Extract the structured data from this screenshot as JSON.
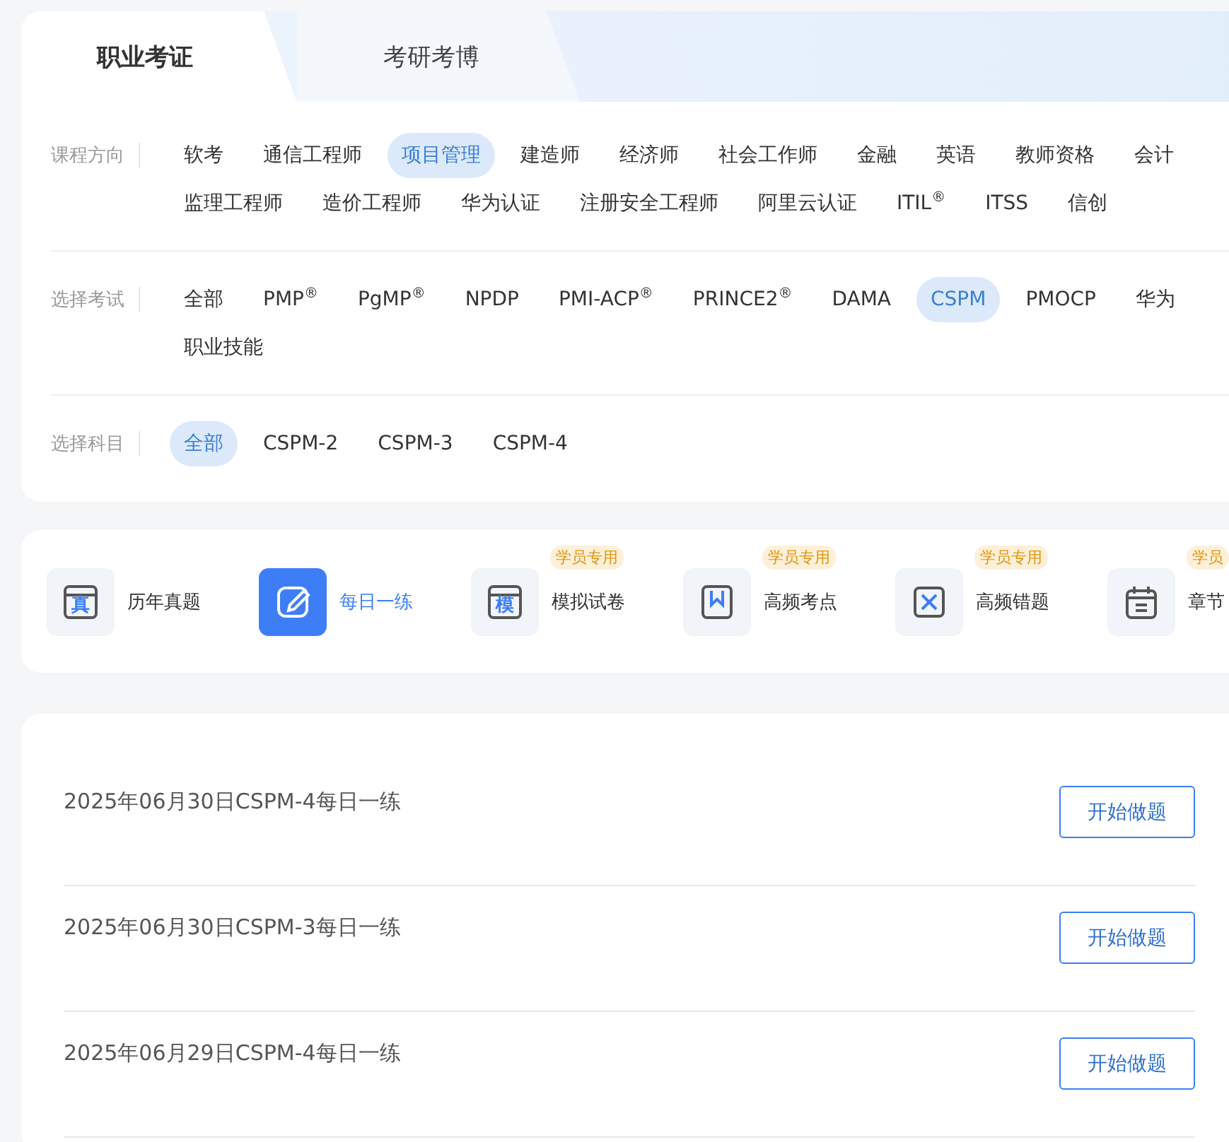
{
  "tabs": [
    {
      "label": "职业考证",
      "selected": true
    },
    {
      "label": "考研考博",
      "selected": false
    }
  ],
  "filters": [
    {
      "label": "课程方向",
      "options": [
        {
          "text": "软考",
          "selected": false
        },
        {
          "text": "通信工程师",
          "selected": false
        },
        {
          "text": "项目管理",
          "selected": true
        },
        {
          "text": "建造师",
          "selected": false
        },
        {
          "text": "经济师",
          "selected": false
        },
        {
          "text": "社会工作师",
          "selected": false
        },
        {
          "text": "金融",
          "selected": false
        },
        {
          "text": "英语",
          "selected": false
        },
        {
          "text": "教师资格",
          "selected": false
        },
        {
          "text": "会计",
          "selected": false
        },
        {
          "text": "监理工程师",
          "selected": false
        },
        {
          "text": "造价工程师",
          "selected": false
        },
        {
          "text": "华为认证",
          "selected": false
        },
        {
          "text": "注册安全工程师",
          "selected": false
        },
        {
          "text": "阿里云认证",
          "selected": false
        },
        {
          "text": "ITIL$^{®}$",
          "selected": false
        },
        {
          "text": "ITSS",
          "selected": false
        },
        {
          "text": "信创",
          "selected": false
        }
      ]
    },
    {
      "label": "选择考试",
      "options": [
        {
          "text": "全部",
          "selected": false
        },
        {
          "text": "PMP$^{®}$",
          "selected": false
        },
        {
          "text": "PgMP$^{®}$",
          "selected": false
        },
        {
          "text": "NPDP",
          "selected": false
        },
        {
          "text": "PMI-ACP$^{®}$",
          "selected": false
        },
        {
          "text": "PRINCE2$^{®}$",
          "selected": false
        },
        {
          "text": "DAMA",
          "selected": false
        },
        {
          "text": "CSPM",
          "selected": true
        },
        {
          "text": "PMOCP",
          "selected": false
        },
        {
          "text": "华为",
          "selected": false
        },
        {
          "text": "职业技能",
          "selected": false
        }
      ]
    },
    {
      "label": "选择科目",
      "options": [
        {
          "text": "全部",
          "selected": true
        },
        {
          "text": "CSPM-2",
          "selected": false
        },
        {
          "text": "CSPM-3",
          "selected": false
        },
        {
          "text": "CSPM-4",
          "selected": false
        }
      ]
    }
  ],
  "tools": [
    {
      "kind": "calendar-glyph",
      "glyph": "真",
      "label": "历年真题",
      "selected": false
    },
    {
      "kind": "pencil",
      "label": "每日一练",
      "selected": true
    },
    {
      "kind": "calendar-glyph",
      "glyph": "模",
      "label": "模拟试卷",
      "selected": false,
      "badge": "学员专用"
    },
    {
      "kind": "bookmark",
      "label": "高频考点",
      "selected": false,
      "badge": "学员专用"
    },
    {
      "kind": "cross",
      "label": "高频错题",
      "selected": false,
      "badge": "学员专用"
    },
    {
      "kind": "calendar",
      "label": "章节",
      "selected": false,
      "badge": "学员"
    }
  ],
  "exercises": [
    {
      "title": "2025年06月30日CSPM-4每日一练",
      "button": "开始做题"
    },
    {
      "title": "2025年06月30日CSPM-3每日一练",
      "button": "开始做题"
    },
    {
      "title": "2025年06月29日CSPM-4每日一练",
      "button": "开始做题"
    }
  ]
}
